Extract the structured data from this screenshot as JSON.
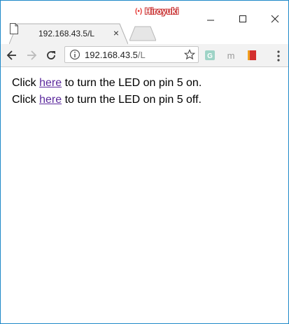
{
  "window": {
    "profile_name": "Hiroyuki",
    "profile_icon": "profile-badge-icon"
  },
  "tab": {
    "title": "192.168.43.5/L",
    "close_label": "×",
    "favicon": "page-icon"
  },
  "toolbar": {
    "url_host": "192.168.43.5",
    "url_path": "/L",
    "extensions": [
      {
        "name": "G",
        "color": "#6fb8a8"
      },
      {
        "name": "m",
        "color": "#8a8a8a"
      },
      {
        "name": "book",
        "color": "#d32f2f"
      }
    ]
  },
  "content": {
    "lines": [
      {
        "prefix": "Click ",
        "link": "here",
        "suffix": " to turn the LED on pin 5 on."
      },
      {
        "prefix": "Click ",
        "link": "here",
        "suffix": " to turn the LED on pin 5 off."
      }
    ]
  },
  "colors": {
    "link_visited": "#5c2a9d",
    "window_border": "#1e88c8",
    "toolbar_bg": "#f2f2f2"
  }
}
